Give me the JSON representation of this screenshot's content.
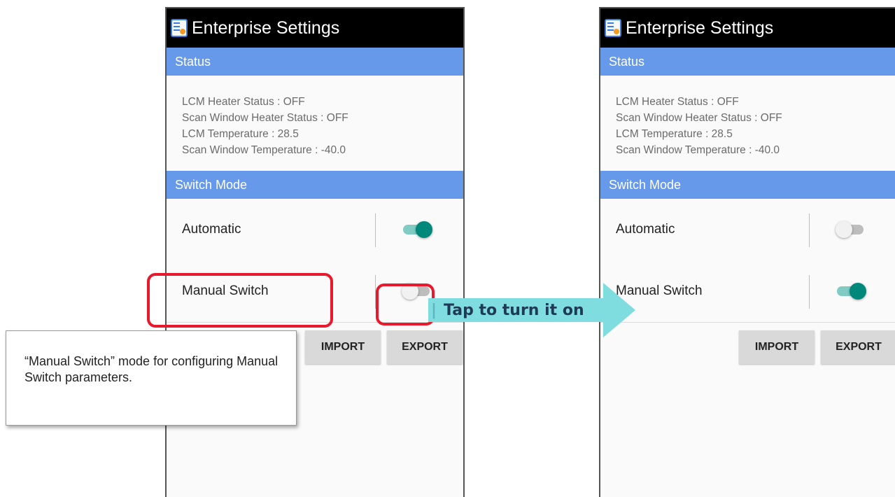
{
  "app": {
    "title": "Enterprise Settings",
    "icon": "settings-app-icon"
  },
  "status_section": {
    "header": "Status",
    "lines": [
      "LCM Heater Status : OFF",
      "Scan Window Heater Status : OFF",
      "LCM Temperature : 28.5",
      "Scan Window Temperature : -40.0"
    ]
  },
  "switch_mode_section": {
    "header": "Switch Mode",
    "automatic_label": "Automatic",
    "manual_label": "Manual Switch"
  },
  "screens": {
    "before": {
      "automatic_on": true,
      "manual_on": false
    },
    "after": {
      "automatic_on": false,
      "manual_on": true
    }
  },
  "buttons": {
    "import_label": "IMPORT",
    "export_label": "EXPORT"
  },
  "annotations": {
    "callout_text": "“Manual Switch” mode for configuring Manual Switch parameters.",
    "arrow_text": "Tap to turn it on",
    "highlight_color": "#e8192c",
    "arrow_color": "#7fdde0"
  },
  "colors": {
    "section_header": "#6699ea",
    "switch_on": "#00897b",
    "title_bar": "#000000"
  }
}
